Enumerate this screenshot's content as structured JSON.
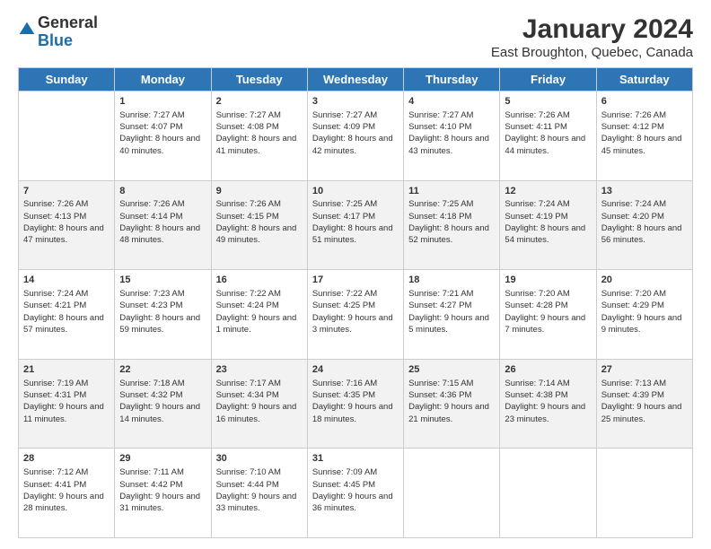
{
  "app": {
    "logo_general": "General",
    "logo_blue": "Blue",
    "title": "January 2024",
    "subtitle": "East Broughton, Quebec, Canada"
  },
  "calendar": {
    "headers": [
      "Sunday",
      "Monday",
      "Tuesday",
      "Wednesday",
      "Thursday",
      "Friday",
      "Saturday"
    ],
    "weeks": [
      [
        {
          "day": "",
          "sunrise": "",
          "sunset": "",
          "daylight": ""
        },
        {
          "day": "1",
          "sunrise": "7:27 AM",
          "sunset": "4:07 PM",
          "daylight": "8 hours and 40 minutes."
        },
        {
          "day": "2",
          "sunrise": "7:27 AM",
          "sunset": "4:08 PM",
          "daylight": "8 hours and 41 minutes."
        },
        {
          "day": "3",
          "sunrise": "7:27 AM",
          "sunset": "4:09 PM",
          "daylight": "8 hours and 42 minutes."
        },
        {
          "day": "4",
          "sunrise": "7:27 AM",
          "sunset": "4:10 PM",
          "daylight": "8 hours and 43 minutes."
        },
        {
          "day": "5",
          "sunrise": "7:26 AM",
          "sunset": "4:11 PM",
          "daylight": "8 hours and 44 minutes."
        },
        {
          "day": "6",
          "sunrise": "7:26 AM",
          "sunset": "4:12 PM",
          "daylight": "8 hours and 45 minutes."
        }
      ],
      [
        {
          "day": "7",
          "sunrise": "7:26 AM",
          "sunset": "4:13 PM",
          "daylight": "8 hours and 47 minutes."
        },
        {
          "day": "8",
          "sunrise": "7:26 AM",
          "sunset": "4:14 PM",
          "daylight": "8 hours and 48 minutes."
        },
        {
          "day": "9",
          "sunrise": "7:26 AM",
          "sunset": "4:15 PM",
          "daylight": "8 hours and 49 minutes."
        },
        {
          "day": "10",
          "sunrise": "7:25 AM",
          "sunset": "4:17 PM",
          "daylight": "8 hours and 51 minutes."
        },
        {
          "day": "11",
          "sunrise": "7:25 AM",
          "sunset": "4:18 PM",
          "daylight": "8 hours and 52 minutes."
        },
        {
          "day": "12",
          "sunrise": "7:24 AM",
          "sunset": "4:19 PM",
          "daylight": "8 hours and 54 minutes."
        },
        {
          "day": "13",
          "sunrise": "7:24 AM",
          "sunset": "4:20 PM",
          "daylight": "8 hours and 56 minutes."
        }
      ],
      [
        {
          "day": "14",
          "sunrise": "7:24 AM",
          "sunset": "4:21 PM",
          "daylight": "8 hours and 57 minutes."
        },
        {
          "day": "15",
          "sunrise": "7:23 AM",
          "sunset": "4:23 PM",
          "daylight": "8 hours and 59 minutes."
        },
        {
          "day": "16",
          "sunrise": "7:22 AM",
          "sunset": "4:24 PM",
          "daylight": "9 hours and 1 minute."
        },
        {
          "day": "17",
          "sunrise": "7:22 AM",
          "sunset": "4:25 PM",
          "daylight": "9 hours and 3 minutes."
        },
        {
          "day": "18",
          "sunrise": "7:21 AM",
          "sunset": "4:27 PM",
          "daylight": "9 hours and 5 minutes."
        },
        {
          "day": "19",
          "sunrise": "7:20 AM",
          "sunset": "4:28 PM",
          "daylight": "9 hours and 7 minutes."
        },
        {
          "day": "20",
          "sunrise": "7:20 AM",
          "sunset": "4:29 PM",
          "daylight": "9 hours and 9 minutes."
        }
      ],
      [
        {
          "day": "21",
          "sunrise": "7:19 AM",
          "sunset": "4:31 PM",
          "daylight": "9 hours and 11 minutes."
        },
        {
          "day": "22",
          "sunrise": "7:18 AM",
          "sunset": "4:32 PM",
          "daylight": "9 hours and 14 minutes."
        },
        {
          "day": "23",
          "sunrise": "7:17 AM",
          "sunset": "4:34 PM",
          "daylight": "9 hours and 16 minutes."
        },
        {
          "day": "24",
          "sunrise": "7:16 AM",
          "sunset": "4:35 PM",
          "daylight": "9 hours and 18 minutes."
        },
        {
          "day": "25",
          "sunrise": "7:15 AM",
          "sunset": "4:36 PM",
          "daylight": "9 hours and 21 minutes."
        },
        {
          "day": "26",
          "sunrise": "7:14 AM",
          "sunset": "4:38 PM",
          "daylight": "9 hours and 23 minutes."
        },
        {
          "day": "27",
          "sunrise": "7:13 AM",
          "sunset": "4:39 PM",
          "daylight": "9 hours and 25 minutes."
        }
      ],
      [
        {
          "day": "28",
          "sunrise": "7:12 AM",
          "sunset": "4:41 PM",
          "daylight": "9 hours and 28 minutes."
        },
        {
          "day": "29",
          "sunrise": "7:11 AM",
          "sunset": "4:42 PM",
          "daylight": "9 hours and 31 minutes."
        },
        {
          "day": "30",
          "sunrise": "7:10 AM",
          "sunset": "4:44 PM",
          "daylight": "9 hours and 33 minutes."
        },
        {
          "day": "31",
          "sunrise": "7:09 AM",
          "sunset": "4:45 PM",
          "daylight": "9 hours and 36 minutes."
        },
        {
          "day": "",
          "sunrise": "",
          "sunset": "",
          "daylight": ""
        },
        {
          "day": "",
          "sunrise": "",
          "sunset": "",
          "daylight": ""
        },
        {
          "day": "",
          "sunrise": "",
          "sunset": "",
          "daylight": ""
        }
      ]
    ]
  }
}
